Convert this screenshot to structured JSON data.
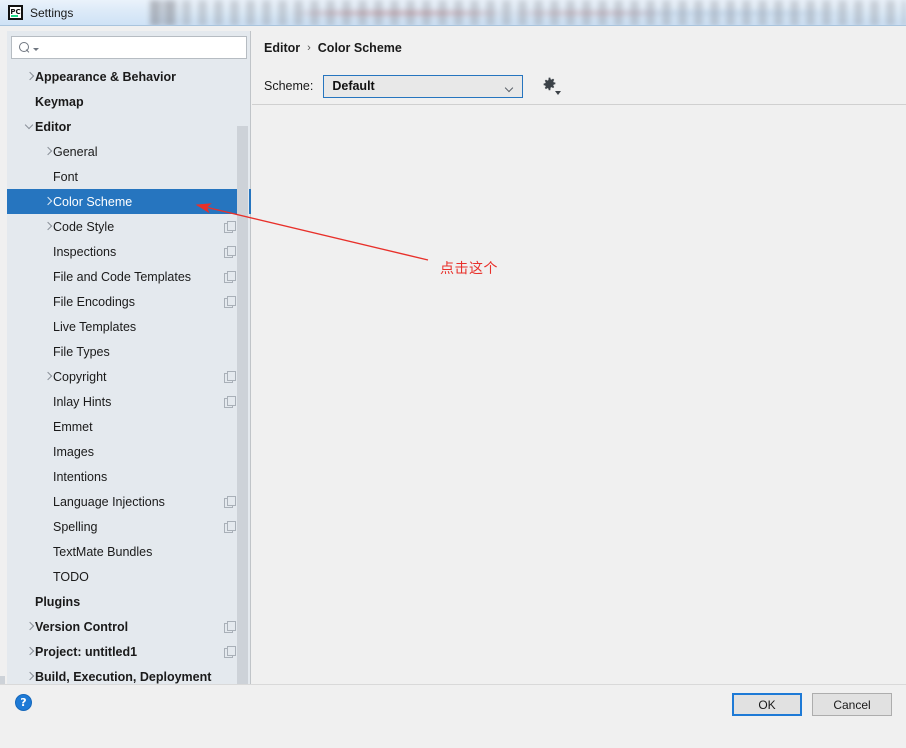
{
  "window": {
    "title": "Settings",
    "app_icon": "pycharm-logo-icon"
  },
  "search": {
    "value": "",
    "placeholder": "",
    "icon": "search-icon"
  },
  "sidebar": {
    "items": [
      {
        "label": "Appearance & Behavior",
        "indent": 0,
        "bold": true,
        "arrow": "right",
        "copy": false,
        "selected": false
      },
      {
        "label": "Keymap",
        "indent": 0,
        "bold": true,
        "arrow": "none",
        "copy": false,
        "selected": false
      },
      {
        "label": "Editor",
        "indent": 0,
        "bold": true,
        "arrow": "down",
        "copy": false,
        "selected": false
      },
      {
        "label": "General",
        "indent": 1,
        "bold": false,
        "arrow": "right",
        "copy": false,
        "selected": false
      },
      {
        "label": "Font",
        "indent": 1,
        "bold": false,
        "arrow": "none",
        "copy": false,
        "selected": false
      },
      {
        "label": "Color Scheme",
        "indent": 1,
        "bold": false,
        "arrow": "right",
        "copy": false,
        "selected": true
      },
      {
        "label": "Code Style",
        "indent": 1,
        "bold": false,
        "arrow": "right",
        "copy": true,
        "selected": false
      },
      {
        "label": "Inspections",
        "indent": 1,
        "bold": false,
        "arrow": "none",
        "copy": true,
        "selected": false
      },
      {
        "label": "File and Code Templates",
        "indent": 1,
        "bold": false,
        "arrow": "none",
        "copy": true,
        "selected": false
      },
      {
        "label": "File Encodings",
        "indent": 1,
        "bold": false,
        "arrow": "none",
        "copy": true,
        "selected": false
      },
      {
        "label": "Live Templates",
        "indent": 1,
        "bold": false,
        "arrow": "none",
        "copy": false,
        "selected": false
      },
      {
        "label": "File Types",
        "indent": 1,
        "bold": false,
        "arrow": "none",
        "copy": false,
        "selected": false
      },
      {
        "label": "Copyright",
        "indent": 1,
        "bold": false,
        "arrow": "right",
        "copy": true,
        "selected": false
      },
      {
        "label": "Inlay Hints",
        "indent": 1,
        "bold": false,
        "arrow": "none",
        "copy": true,
        "selected": false
      },
      {
        "label": "Emmet",
        "indent": 1,
        "bold": false,
        "arrow": "none",
        "copy": false,
        "selected": false
      },
      {
        "label": "Images",
        "indent": 1,
        "bold": false,
        "arrow": "none",
        "copy": false,
        "selected": false
      },
      {
        "label": "Intentions",
        "indent": 1,
        "bold": false,
        "arrow": "none",
        "copy": false,
        "selected": false
      },
      {
        "label": "Language Injections",
        "indent": 1,
        "bold": false,
        "arrow": "none",
        "copy": true,
        "selected": false
      },
      {
        "label": "Spelling",
        "indent": 1,
        "bold": false,
        "arrow": "none",
        "copy": true,
        "selected": false
      },
      {
        "label": "TextMate Bundles",
        "indent": 1,
        "bold": false,
        "arrow": "none",
        "copy": false,
        "selected": false
      },
      {
        "label": "TODO",
        "indent": 1,
        "bold": false,
        "arrow": "none",
        "copy": false,
        "selected": false
      },
      {
        "label": "Plugins",
        "indent": 0,
        "bold": true,
        "arrow": "none",
        "copy": false,
        "selected": false
      },
      {
        "label": "Version Control",
        "indent": 0,
        "bold": true,
        "arrow": "right",
        "copy": true,
        "selected": false
      },
      {
        "label": "Project: untitled1",
        "indent": 0,
        "bold": true,
        "arrow": "right",
        "copy": true,
        "selected": false
      },
      {
        "label": "Build, Execution, Deployment",
        "indent": 0,
        "bold": true,
        "arrow": "right",
        "copy": false,
        "selected": false
      }
    ]
  },
  "main": {
    "breadcrumb": {
      "parent": "Editor",
      "separator": "›",
      "current": "Color Scheme"
    },
    "scheme": {
      "label": "Scheme:",
      "value": "Default",
      "gear_icon": "gear-icon",
      "caret_icon": "chevron-down-icon"
    }
  },
  "annotation": {
    "text": "点击这个",
    "color": "#e8302a"
  },
  "footer": {
    "help_label": "?",
    "ok_label": "OK",
    "cancel_label": "Cancel"
  },
  "colors": {
    "selection_blue": "#2675bf",
    "sidebar_bg": "#e4e9ee",
    "panel_bg": "#f0f0f0",
    "accent": "#1e7ad6",
    "annotation_red": "#e8302a"
  }
}
